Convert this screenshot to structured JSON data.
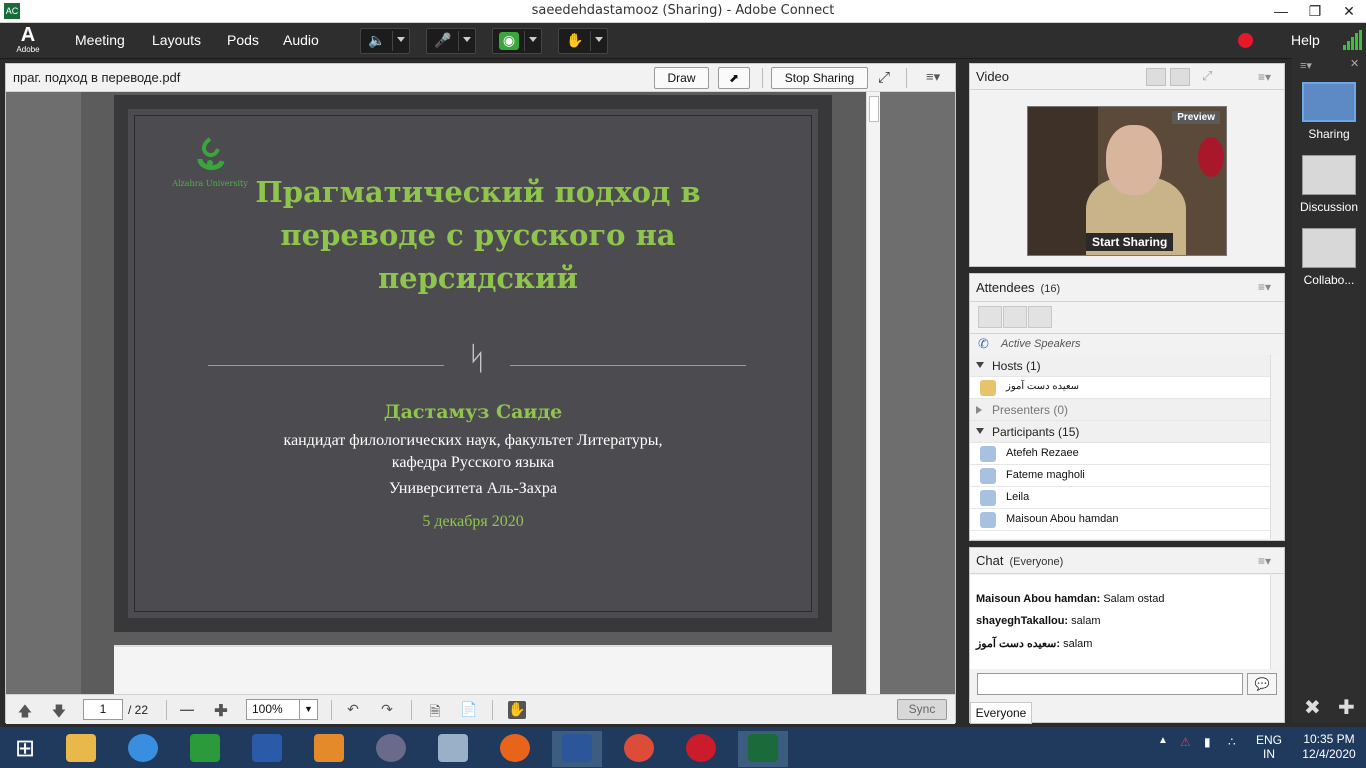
{
  "window": {
    "title": "saeedehdastamooz (Sharing) - Adobe Connect",
    "buttons": [
      "minimize",
      "maximize",
      "close"
    ]
  },
  "menubar": {
    "logo_text": "Adobe",
    "items": [
      "Meeting",
      "Layouts",
      "Pods",
      "Audio"
    ],
    "help": "Help",
    "record_color": "#e8172a"
  },
  "share_pod": {
    "filename": "праг. подход в переводе.pdf",
    "draw_label": "Draw",
    "stop_sharing_label": "Stop Sharing",
    "page_current": "1",
    "page_total": "/ 22",
    "zoom": "100%",
    "sync_label": "Sync"
  },
  "slide": {
    "university": "Alzahra University",
    "title": "Прагматический подход в переводе с русского на персидский",
    "author": "Дастамуз Саиде",
    "line1": "кандидат филологических наук, факультет Литературы,",
    "line2": "кафедра Русского языка",
    "line3": "Университета Аль-Захра",
    "date": "5 декабря 2020",
    "accent_color": "#8fc54c"
  },
  "video_pod": {
    "title": "Video",
    "preview_label": "Preview",
    "start_sharing_label": "Start Sharing"
  },
  "attendees_pod": {
    "title": "Attendees",
    "count": "(16)",
    "active_speakers": "Active Speakers",
    "hosts_label": "Hosts (1)",
    "host_name": "سعیده دست آموز",
    "presenters_label": "Presenters (0)",
    "participants_label": "Participants (15)",
    "participants": [
      "Atefeh Rezaee",
      "Fateme magholi",
      "Leila",
      "Maisoun Abou hamdan"
    ]
  },
  "chat_pod": {
    "title": "Chat",
    "scope": "(Everyone)",
    "messages": [
      {
        "sender": "Maisoun Abou hamdan:",
        "text": "Salam ostad"
      },
      {
        "sender": "shayeghTakallou:",
        "text": "salam"
      },
      {
        "sender": "سعیده دست آموز:",
        "text": "salam"
      }
    ],
    "tab_label": "Everyone"
  },
  "layouts": {
    "items": [
      "Sharing",
      "Discussion",
      "Collabo..."
    ],
    "selected": "Sharing"
  },
  "taskbar": {
    "apps": [
      "start",
      "file-explorer",
      "internet-explorer",
      "store",
      "help",
      "app-grid",
      "media-player",
      "calculator",
      "firefox",
      "word",
      "chrome",
      "opera",
      "adobe-connect"
    ],
    "language": "ENG",
    "region": "IN",
    "time": "10:35 PM",
    "date": "12/4/2020"
  }
}
